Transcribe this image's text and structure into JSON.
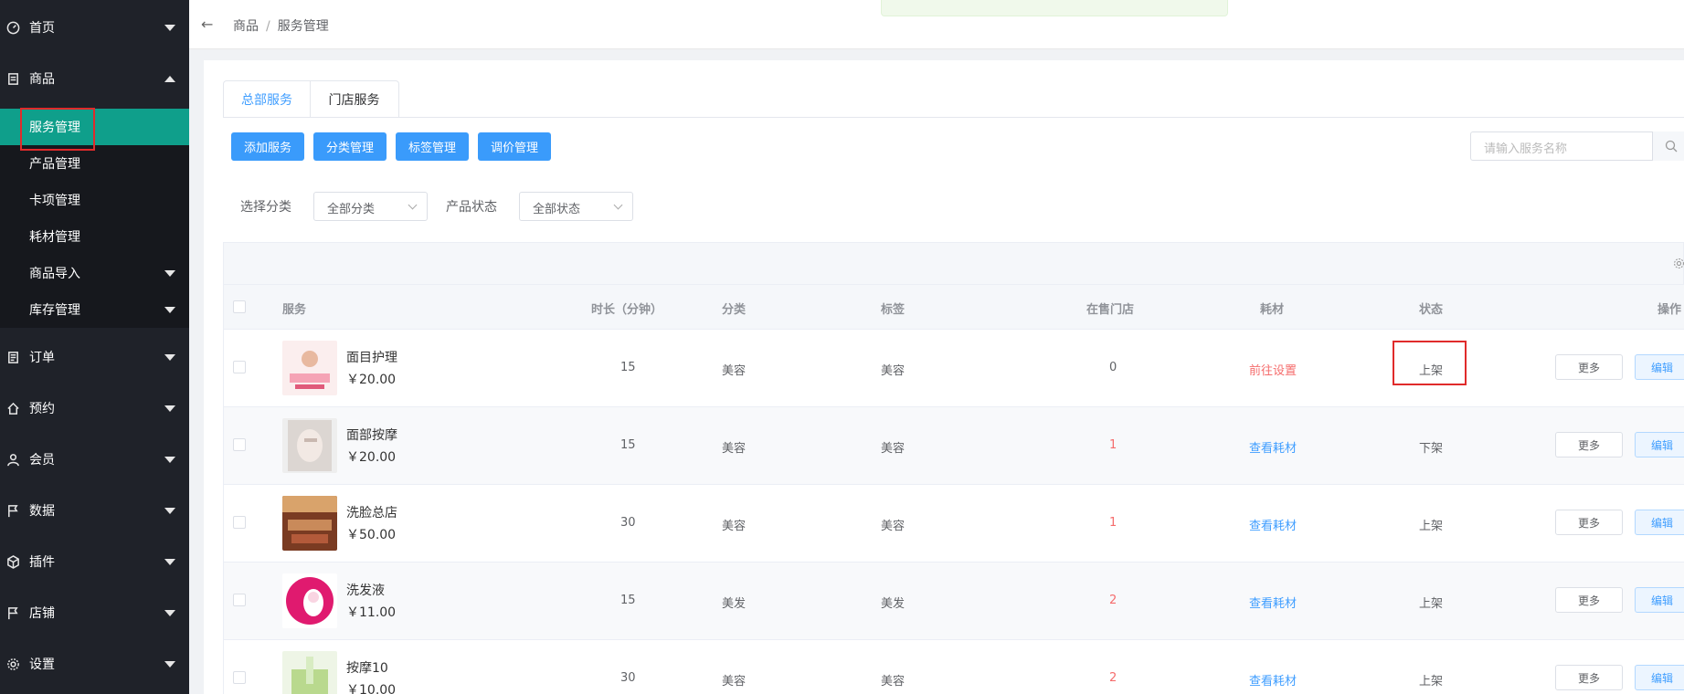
{
  "sidebar": {
    "home": "首页",
    "goods": "商品",
    "goods_sub": [
      "服务管理",
      "产品管理",
      "卡项管理",
      "耗材管理",
      "商品导入",
      "库存管理"
    ],
    "orders": "订单",
    "booking": "预约",
    "members": "会员",
    "data": "数据",
    "plugins": "插件",
    "stores": "店铺",
    "settings": "设置"
  },
  "breadcrumb": {
    "root": "商品",
    "sep": "/",
    "current": "服务管理"
  },
  "tabs": [
    "总部服务",
    "门店服务"
  ],
  "toolbar": {
    "add": "添加服务",
    "category": "分类管理",
    "tags": "标签管理",
    "price": "调价管理",
    "search_placeholder": "请输入服务名称"
  },
  "filters": {
    "category_label": "选择分类",
    "category_value": "全部分类",
    "status_label": "产品状态",
    "status_value": "全部状态"
  },
  "table": {
    "headers": [
      "服务",
      "时长（分钟）",
      "分类",
      "标签",
      "在售门店",
      "耗材",
      "状态",
      "操作"
    ],
    "rows": [
      {
        "name": "面目护理",
        "price": "￥20.00",
        "duration": "15",
        "category": "美容",
        "tag": "美容",
        "stores": "0",
        "material": "前往设置",
        "status": "上架",
        "more": "更多",
        "edit": "编辑"
      },
      {
        "name": "面部按摩",
        "price": "￥20.00",
        "duration": "15",
        "category": "美容",
        "tag": "美容",
        "stores": "1",
        "material": "查看耗材",
        "status": "下架",
        "more": "更多",
        "edit": "编辑"
      },
      {
        "name": "洗脸总店",
        "price": "￥50.00",
        "duration": "30",
        "category": "美容",
        "tag": "美容",
        "stores": "1",
        "material": "查看耗材",
        "status": "上架",
        "more": "更多",
        "edit": "编辑"
      },
      {
        "name": "洗发液",
        "price": "￥11.00",
        "duration": "15",
        "category": "美发",
        "tag": "美发",
        "stores": "2",
        "material": "查看耗材",
        "status": "上架",
        "more": "更多",
        "edit": "编辑"
      },
      {
        "name": "按摩10",
        "price": "￥10.00",
        "duration": "30",
        "category": "美容",
        "tag": "美容",
        "stores": "2",
        "material": "查看耗材",
        "status": "上架",
        "more": "更多",
        "edit": "编辑"
      }
    ]
  },
  "colors": {
    "sidebar_bg": "#1f2229",
    "active_item": "#0f9f8b",
    "primary": "#409eff",
    "danger": "#f56c6c",
    "highlight_box": "#e02b2b"
  }
}
